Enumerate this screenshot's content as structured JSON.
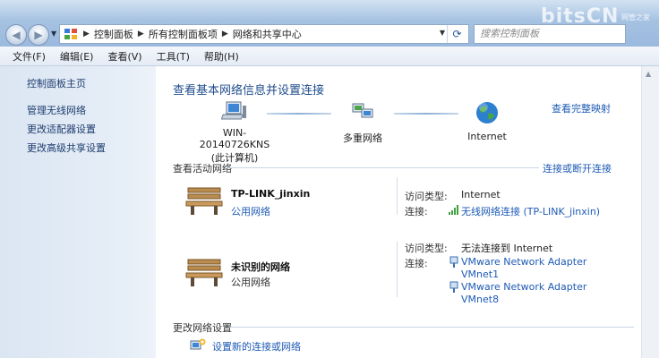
{
  "address": {
    "breadcrumbs": [
      "控制面板",
      "所有控制面板项",
      "网络和共享中心"
    ],
    "search_placeholder": "搜索控制面板"
  },
  "watermark": {
    "brand": "bitsCN",
    "suffix": ".com",
    "sub": "网管之家"
  },
  "menu": [
    "文件(F)",
    "编辑(E)",
    "查看(V)",
    "工具(T)",
    "帮助(H)"
  ],
  "left_pane": {
    "home": "控制面板主页",
    "links": [
      "管理无线网络",
      "更改适配器设置",
      "更改高级共享设置"
    ]
  },
  "main": {
    "heading": "查看基本网络信息并设置连接",
    "full_map_link": "查看完整映射",
    "map_nodes": [
      {
        "label": "WIN-20140726KNS",
        "sub": "(此计算机)",
        "icon": "computer-icon"
      },
      {
        "label": "多重网络",
        "icon": "multiple-networks-icon"
      },
      {
        "label": "Internet",
        "icon": "globe-icon"
      }
    ],
    "active_networks": {
      "title": "查看活动网络",
      "connect_link": "连接或断开连接",
      "networks": [
        {
          "name": "TP-LINK_jinxin",
          "type": "公用网络",
          "type_is_link": true,
          "access_label": "访问类型:",
          "access_value": "Internet",
          "conn_label": "连接:",
          "connections": [
            "无线网络连接 (TP-LINK_jinxin)"
          ]
        },
        {
          "name": "未识别的网络",
          "type": "公用网络",
          "type_is_link": false,
          "access_label": "访问类型:",
          "access_value": "无法连接到 Internet",
          "conn_label": "连接:",
          "connections": [
            "VMware Network Adapter VMnet1",
            "VMware Network Adapter VMnet8"
          ]
        }
      ]
    },
    "change_settings": {
      "title": "更改网络设置",
      "setup_link": "设置新的连接或网络"
    }
  },
  "colors": {
    "link": "#1e5bb5",
    "heading": "#1e4c8c",
    "titlebar": "#a6c2e2"
  }
}
